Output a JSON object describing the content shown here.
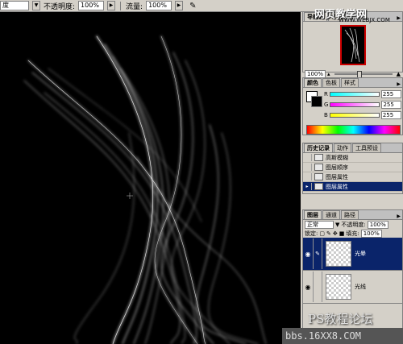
{
  "options_bar": {
    "mode_value": "度",
    "opacity_label": "不透明度:",
    "opacity_value": "100%",
    "flow_label": "流量:",
    "flow_value": "100%"
  },
  "navigator": {
    "tabs": [
      "导航器",
      "信息"
    ],
    "zoom": "100%"
  },
  "color_panel": {
    "tabs": [
      "颜色",
      "色板",
      "样式"
    ],
    "channels": [
      {
        "label": "R",
        "value": "255",
        "color": "#e04040"
      },
      {
        "label": "G",
        "value": "255",
        "color": "#c040c0"
      },
      {
        "label": "B",
        "value": "255",
        "color": "#c0c040"
      }
    ]
  },
  "history_panel": {
    "tabs": [
      "历史记录",
      "动作",
      "工具预设"
    ],
    "items": [
      {
        "label": "高斯模糊",
        "active": false
      },
      {
        "label": "图层顺序",
        "active": false
      },
      {
        "label": "图层属性",
        "active": false
      },
      {
        "label": "图层属性",
        "active": true
      }
    ]
  },
  "layers_panel": {
    "tabs": [
      "图层",
      "通道",
      "路径"
    ],
    "blend_mode": "正常",
    "opacity_label": "不透明度:",
    "opacity_value": "100%",
    "lock_label": "锁定:",
    "fill_label": "填充:",
    "fill_value": "100%",
    "layers": [
      {
        "name": "光晕",
        "active": true
      },
      {
        "name": "光线",
        "active": false
      }
    ]
  },
  "watermarks": {
    "top": "网页教学网",
    "top_url": "WWW.WEBJX.COM",
    "bottom": "PS教程论坛",
    "bottom_url": "bbs.16XX8.COM"
  }
}
